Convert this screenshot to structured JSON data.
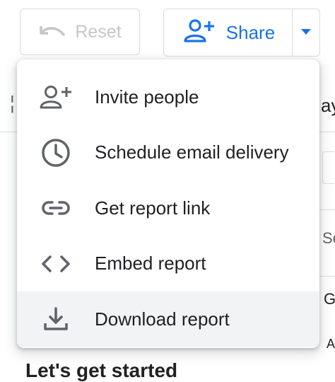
{
  "toolbar": {
    "reset_label": "Reset",
    "share_label": "Share"
  },
  "background": {
    "fragment_left": "¦",
    "fragment_ay": "ay",
    "fragment_se": "Se",
    "fragment_g": "G",
    "fragment_a": "A"
  },
  "menu": {
    "items": [
      {
        "label": "Invite people",
        "icon": "add-person-icon"
      },
      {
        "label": "Schedule email delivery",
        "icon": "clock-icon"
      },
      {
        "label": "Get report link",
        "icon": "link-icon"
      },
      {
        "label": "Embed report",
        "icon": "code-icon"
      },
      {
        "label": "Download report",
        "icon": "download-icon"
      }
    ],
    "highlighted_index": 4
  },
  "page": {
    "bottom_heading": "Let's get started"
  },
  "colors": {
    "accent": "#1a73e8",
    "icon": "#5f6368",
    "disabled": "#c4c7c5",
    "highlight_bg": "#f1f3f4"
  }
}
